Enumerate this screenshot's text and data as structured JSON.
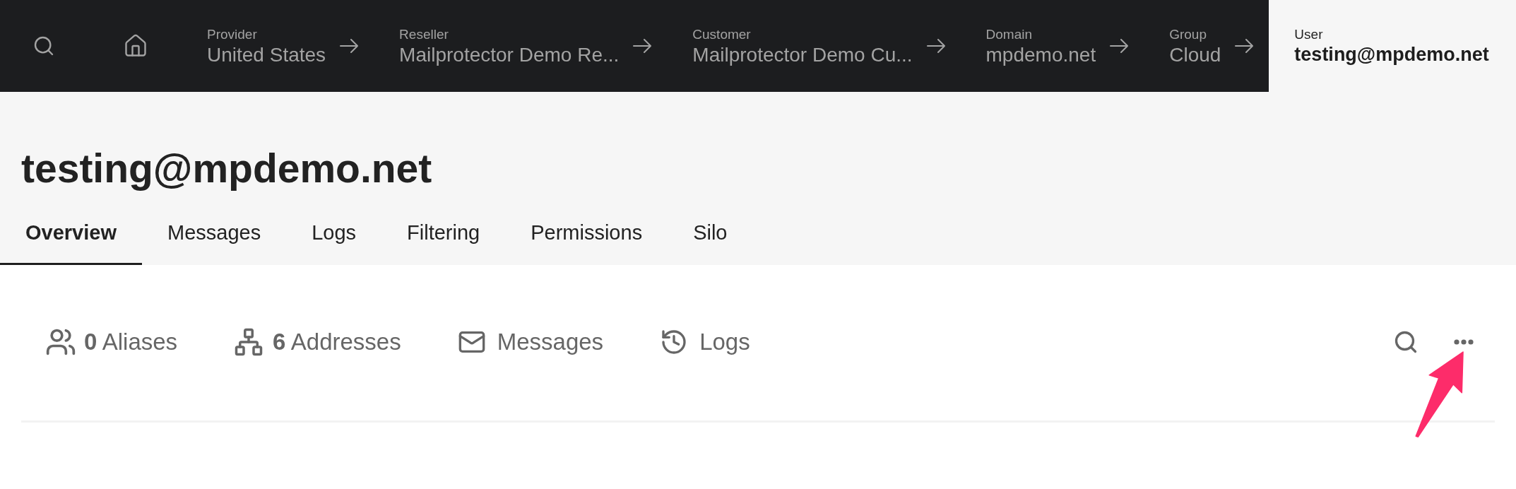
{
  "top_nav": {
    "breadcrumbs": [
      {
        "label": "Provider",
        "value": "United States",
        "selected": false
      },
      {
        "label": "Reseller",
        "value": "Mailprotector Demo Re...",
        "selected": false
      },
      {
        "label": "Customer",
        "value": "Mailprotector Demo Cu...",
        "selected": false
      },
      {
        "label": "Domain",
        "value": "mpdemo.net",
        "selected": false
      },
      {
        "label": "Group",
        "value": "Cloud",
        "selected": false
      },
      {
        "label": "User",
        "value": "testing@mpdemo.net",
        "selected": true
      }
    ]
  },
  "page_header": {
    "title": "testing@mpdemo.net",
    "tabs": [
      {
        "label": "Overview",
        "selected": true
      },
      {
        "label": "Messages",
        "selected": false
      },
      {
        "label": "Logs",
        "selected": false
      },
      {
        "label": "Filtering",
        "selected": false
      },
      {
        "label": "Permissions",
        "selected": false
      },
      {
        "label": "Silo",
        "selected": false
      }
    ]
  },
  "overview": {
    "links": [
      {
        "kind": "aliases",
        "text": "**0** Aliases"
      },
      {
        "kind": "addresses",
        "text": "**6** Addresses"
      },
      {
        "kind": "messages",
        "text": "Messages"
      },
      {
        "kind": "logs",
        "text": "Logs"
      }
    ]
  }
}
